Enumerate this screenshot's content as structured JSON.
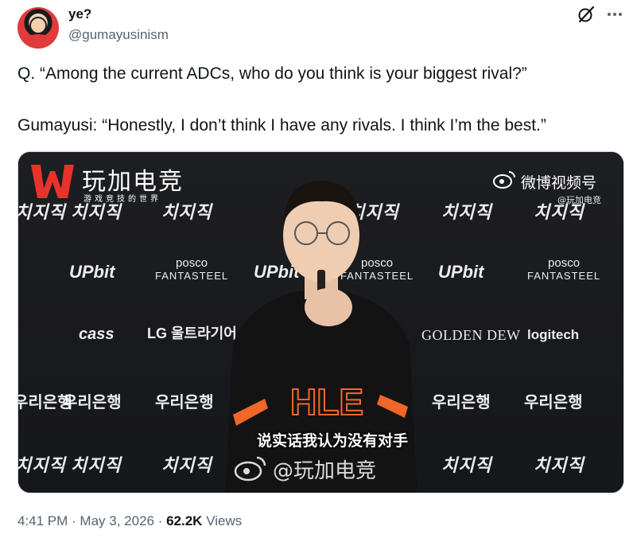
{
  "author": {
    "display_name": "ye?",
    "handle": "@gumayusinism"
  },
  "icons": {
    "grok": "grok-slash-icon",
    "more": "more-horizontal-icon",
    "weibo": "weibo-icon"
  },
  "tweet": {
    "line1": "Q. “Among the current ADCs, who do you think is your biggest rival?”",
    "line2": "Gumayusi: “Honestly, I don’t think I have any rivals. I think I’m the best.”"
  },
  "media": {
    "brand_title": "玩加电竞",
    "brand_subtitle": "游戏竞技的世界",
    "weibo_video_label": "微博视频号",
    "weibo_small_handle": "@玩加电竞",
    "subtitle": "说实话我认为没有对手",
    "watermark": "@玩加电竞",
    "jersey_text": "HLE",
    "sponsors": {
      "chiji": "치지직",
      "upbit": "UPbit",
      "posco_top": "posco",
      "posco_bottom": "FANTASTEEL",
      "woori": "우리은행",
      "golden": "GOLDEN DEW",
      "logitech": "logitech",
      "lg": "LG 울트라기어",
      "cass": "cass"
    },
    "accent_colors": {
      "brand_red": "#e8322b",
      "orange": "#f2662a"
    }
  },
  "meta": {
    "time": "4:41 PM",
    "sep1": " · ",
    "date": "May 3, 2026",
    "sep2": " · ",
    "views_count": "62.2K",
    "views_label": " Views"
  }
}
